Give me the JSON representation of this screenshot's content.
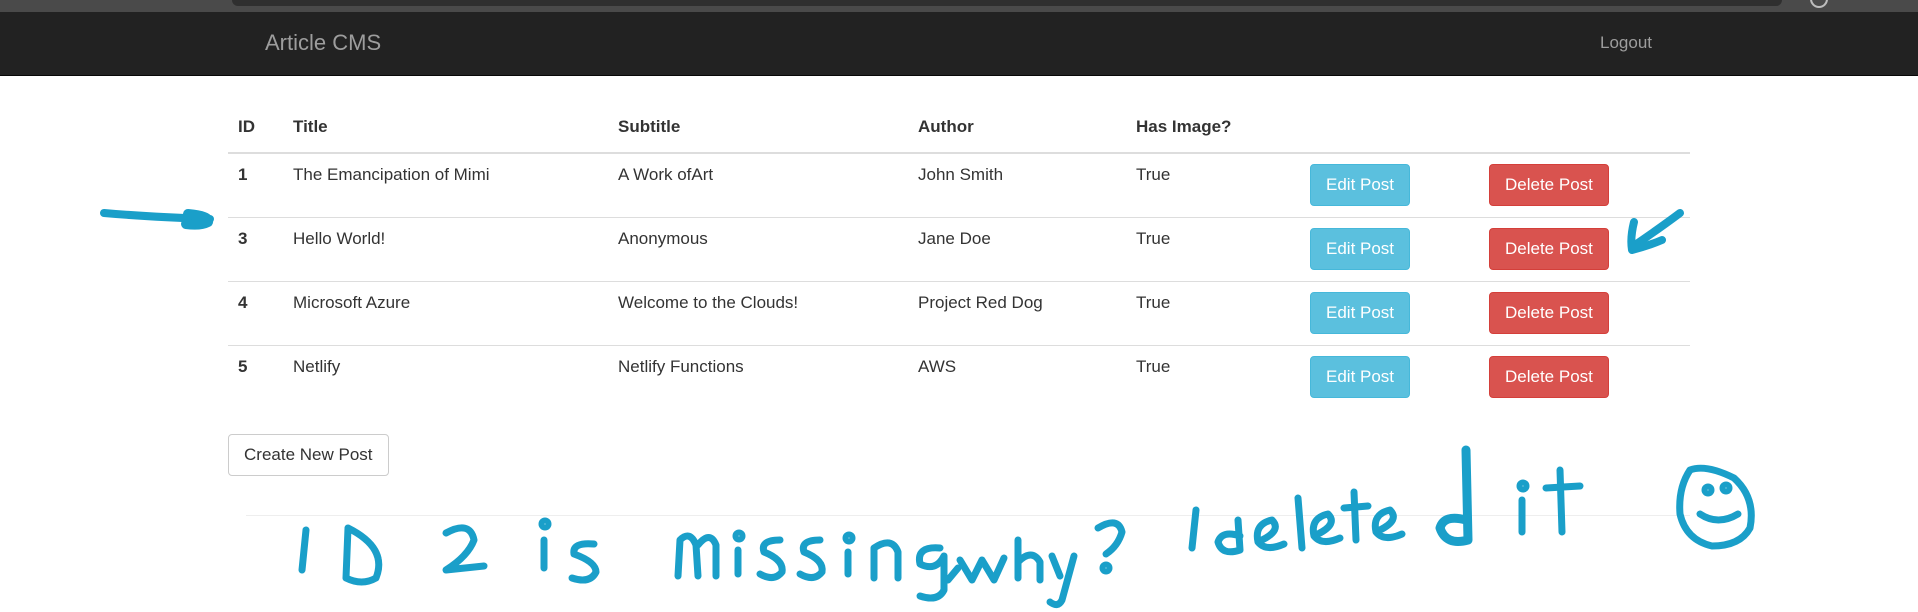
{
  "navbar": {
    "brand": "Article CMS",
    "logout_label": "Logout"
  },
  "table": {
    "headers": [
      "ID",
      "Title",
      "Subtitle",
      "Author",
      "Has Image?"
    ],
    "rows": [
      {
        "id": "1",
        "title": "The Emancipation of Mimi",
        "subtitle": "A Work ofArt",
        "author": "John Smith",
        "has_image": "True",
        "edit_label": "Edit Post",
        "delete_label": "Delete Post"
      },
      {
        "id": "3",
        "title": "Hello World!",
        "subtitle": "Anonymous",
        "author": "Jane Doe",
        "has_image": "True",
        "edit_label": "Edit Post",
        "delete_label": "Delete Post"
      },
      {
        "id": "4",
        "title": "Microsoft Azure",
        "subtitle": "Welcome to the Clouds!",
        "author": "Project Red Dog",
        "has_image": "True",
        "edit_label": "Edit Post",
        "delete_label": "Delete Post"
      },
      {
        "id": "5",
        "title": "Netlify",
        "subtitle": "Netlify Functions",
        "author": "AWS",
        "has_image": "True",
        "edit_label": "Edit Post",
        "delete_label": "Delete Post"
      }
    ]
  },
  "create_button_label": "Create New Post",
  "annotation": {
    "handwritten_note": "ID 2 is missing, why? I deleted it",
    "ink_color": "#1a9fc9"
  },
  "colors": {
    "navbar_bg": "#222222",
    "info": "#5bc0de",
    "danger": "#d9534f"
  }
}
